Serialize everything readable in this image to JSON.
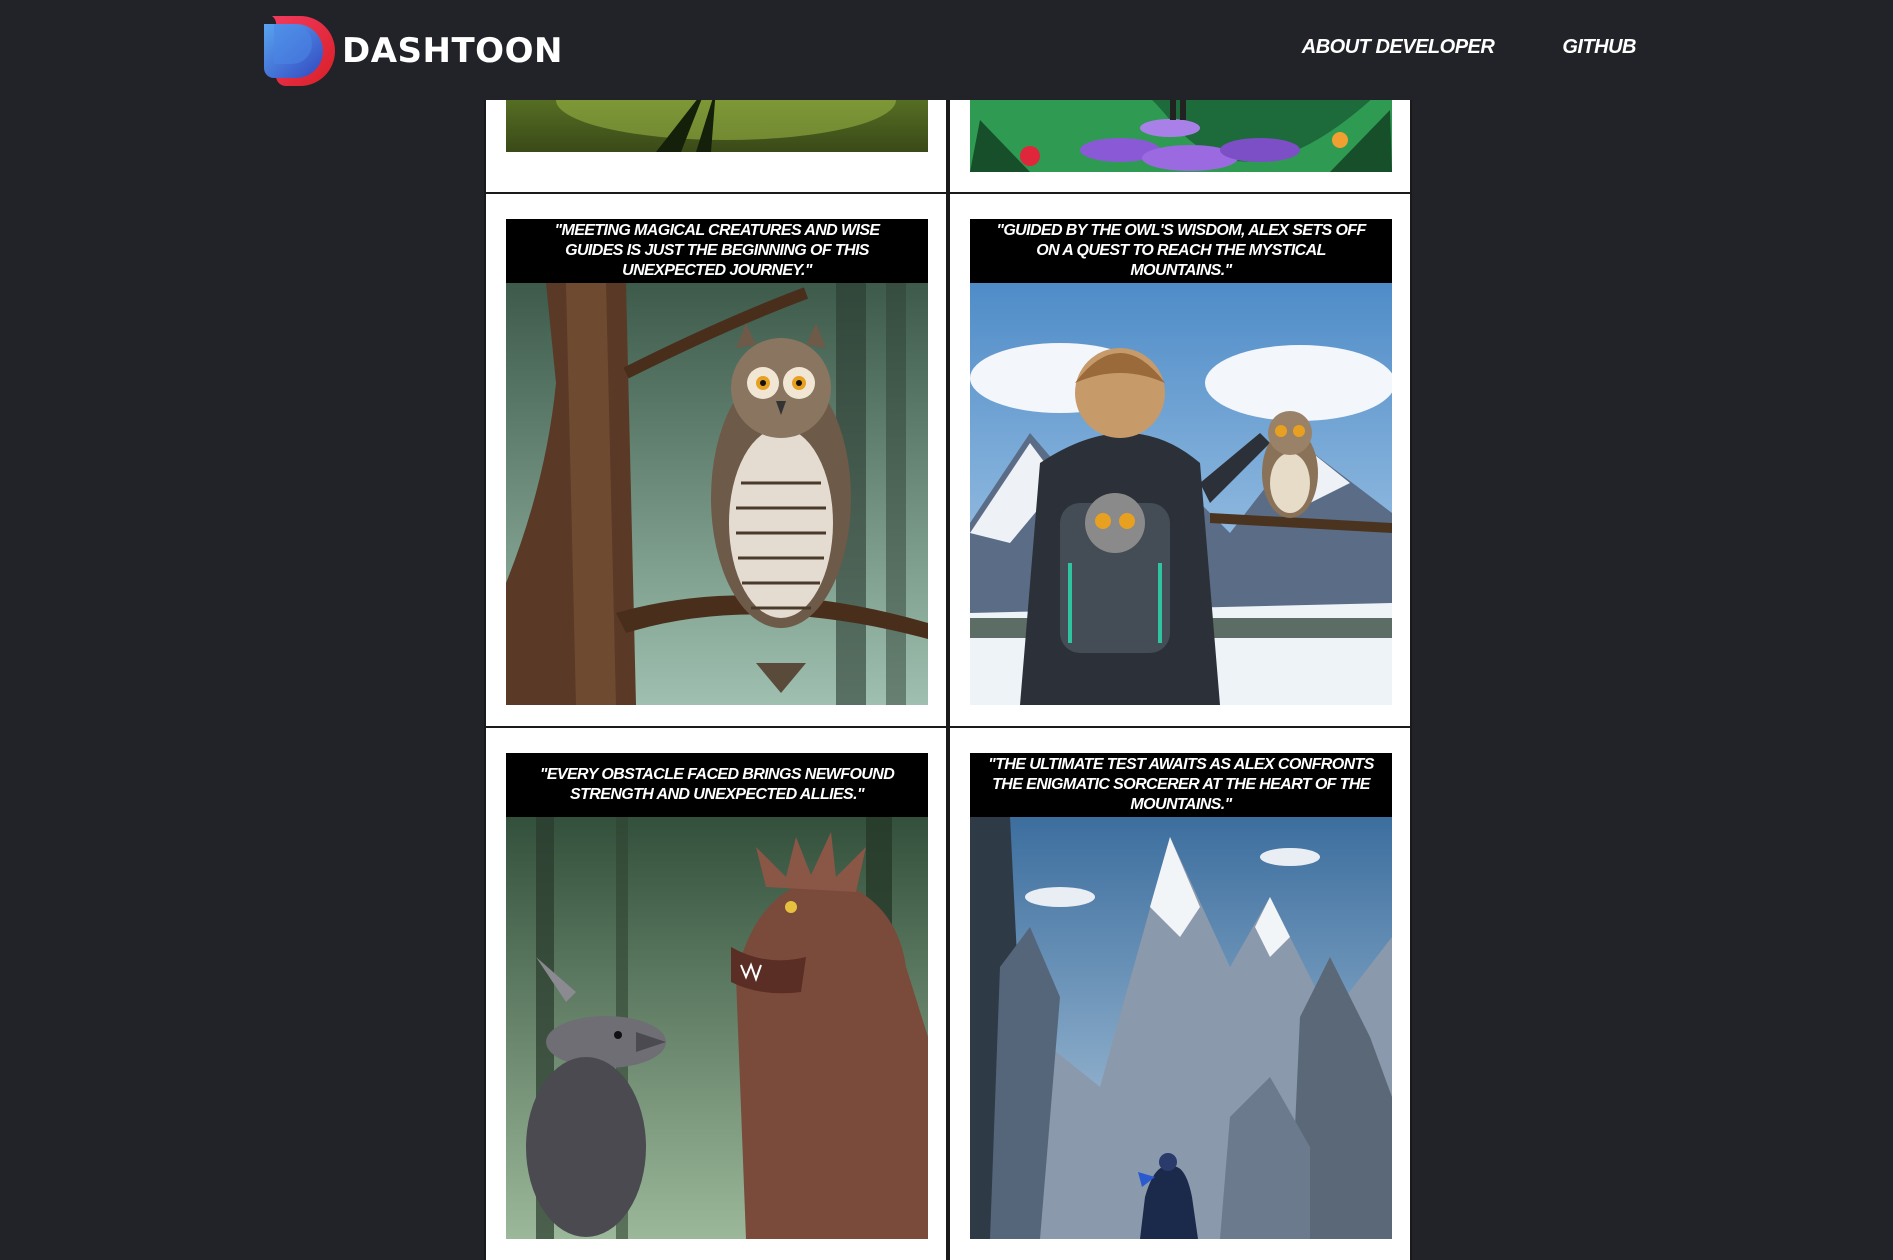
{
  "brand": {
    "name": "DASHTOON"
  },
  "nav": {
    "about": "About Developer",
    "github": "GitHub"
  },
  "panels": [
    {
      "caption": "",
      "scene": "meadow-road"
    },
    {
      "caption": "",
      "scene": "flower-path"
    },
    {
      "caption": "\"Meeting magical creatures and wise guides is just the beginning of this unexpected journey.\"",
      "scene": "forest-owl"
    },
    {
      "caption": "\"Guided by the owl's wisdom, Alex sets off on a quest to reach the mystical mountains.\"",
      "scene": "mountain-boy-owl"
    },
    {
      "caption": "\"Every obstacle faced brings newfound strength and unexpected allies.\"",
      "scene": "forest-dragon"
    },
    {
      "caption": "\"The ultimate test awaits as Alex confronts the enigmatic sorcerer at the heart of the mountains.\"",
      "scene": "mountain-peaks"
    }
  ],
  "colors": {
    "header_bg": "#212328",
    "panel_bg": "#ffffff",
    "caption_bg": "#000000",
    "logo_red": "#e8262c",
    "logo_blue": "#3a6fd8"
  }
}
